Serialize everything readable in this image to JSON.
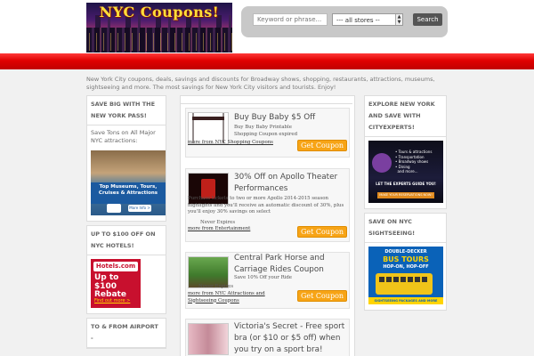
{
  "header": {
    "logo_text": "NYC Coupons!",
    "search_placeholder": "Keyword or phrase...",
    "store_select": "--- all stores --",
    "search_button": "Search"
  },
  "intro": "New York City coupons, deals, savings and discounts for Broadway shows, shopping, restaurants, attractions, museums, sightseeing and more. The most savings for New York City visitors and tourists. Enjoy!",
  "left": {
    "w1_title": "Save Big With The New York Pass!",
    "w1_text": "Save Tons on All Major NYC attractions:",
    "w1_ad": "Top Museums, Tours, Cruises & Attractions",
    "w1_ad_more": "More Info >",
    "w2_title": "Up To $100 Off On NYC Hotels!",
    "w2_brand": "Hotels.com",
    "w2_big": "Up to $100 Rebate",
    "w2_small": "Find out more >",
    "w3_title": "To & From Airport -"
  },
  "right": {
    "w1_title": "Explore New York and Save With CityExperts!",
    "w1_list": "• Tours & attractions\n• Transportation\n• Broadway shows\n• Dining\n  and more...",
    "w1_cta": "LET THE EXPERTS GUIDE YOU!",
    "w1_cta2": "MAKE YOUR RESERVATIONS NOW!",
    "w2_title": "Save On NYC Sightseeing!",
    "w2_h1": "DOUBLE-DECKER",
    "w2_h2": "BUS TOURS",
    "w2_h3": "HOP-ON, HOP-OFF",
    "w2_foot": "SIGHTSEEING PACKAGES AND MORE"
  },
  "coupons": [
    {
      "title": "Buy Buy Baby $5 Off",
      "desc": "Buy Buy Baby Printable Shopping Coupon expired",
      "link": "more from NYC Shopping Coupons",
      "button": "Get Coupon"
    },
    {
      "title": "30% Off on Apollo Theater Performances",
      "desc": "Purchase tickets to two or more Apollo 2014-2015 season highlights and you'll receive an automatic discount of 30%, plus you'll enjoy 30% savings on select",
      "expire": "Never Expires",
      "link": "more from Entertainment",
      "button": "Get Coupon"
    },
    {
      "title": "Central Park Horse and Carriage Rides Coupon",
      "desc": "Save 10% Off your Ride",
      "expire": "Never Expires",
      "link": "more from NYC Attractions and Sightseeing Coupons",
      "button": "Get Coupon"
    },
    {
      "title": "Victoria's Secret - Free sport bra (or $10 or $5 off) when you try on a sport bra!"
    }
  ]
}
